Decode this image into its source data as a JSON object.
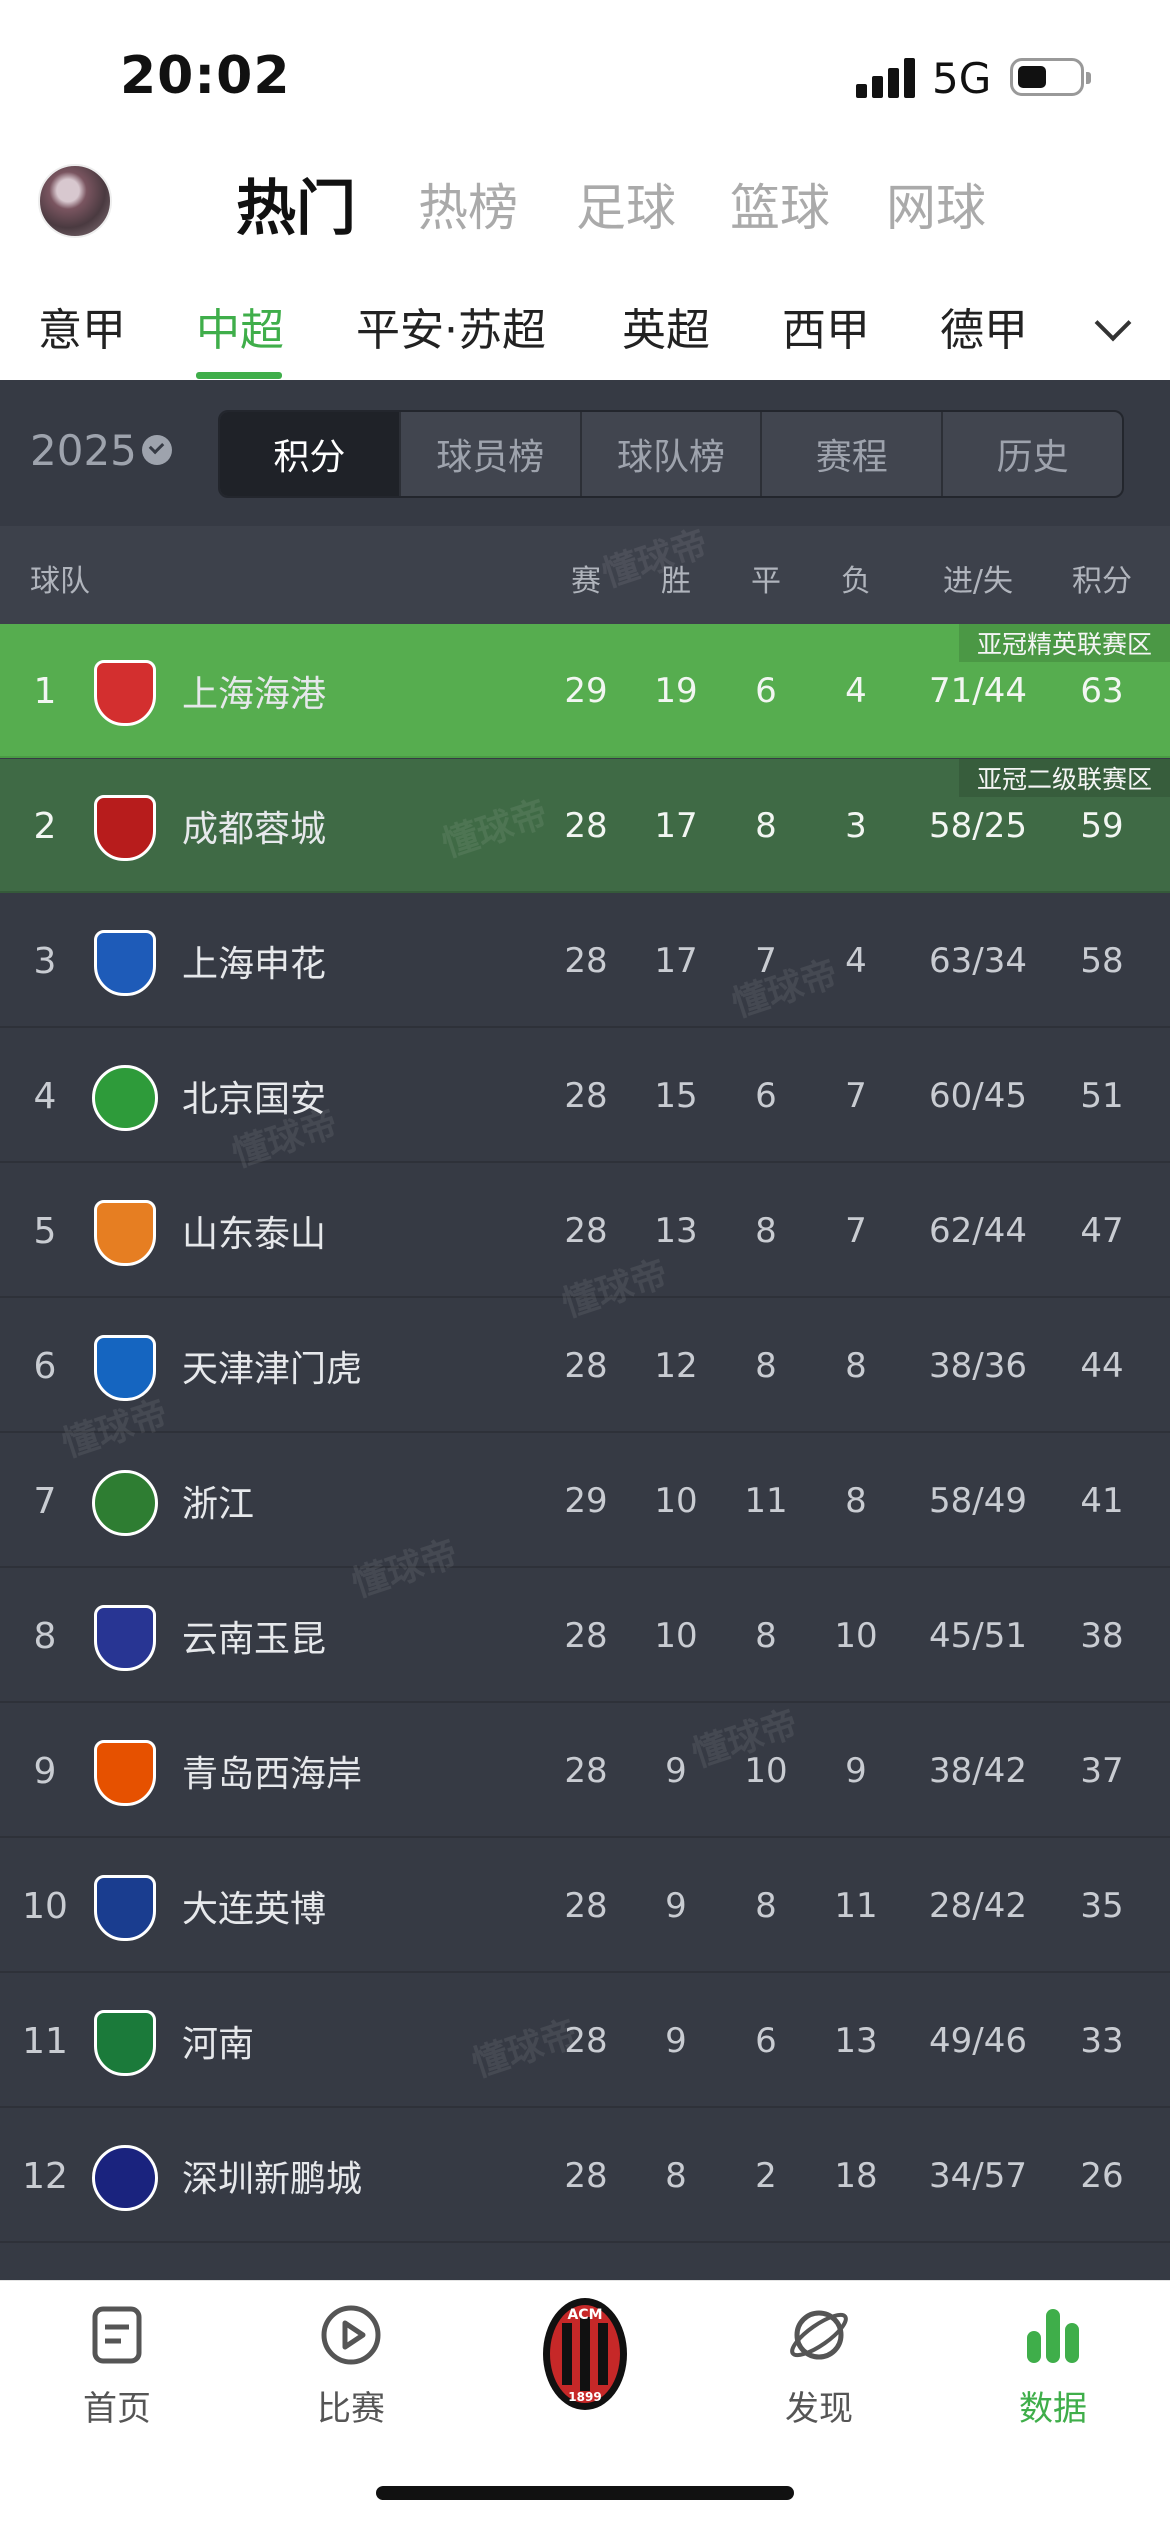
{
  "status_bar": {
    "time": "20:02",
    "network": "5G"
  },
  "top_tabs": [
    "热门",
    "热榜",
    "足球",
    "篮球",
    "网球"
  ],
  "league_tabs": [
    "意甲",
    "中超",
    "平安·苏超",
    "英超",
    "西甲",
    "德甲"
  ],
  "season": "2025",
  "segments": [
    "积分",
    "球员榜",
    "球队榜",
    "赛程",
    "历史"
  ],
  "table_headers": {
    "team": "球队",
    "played": "赛",
    "won": "胜",
    "drawn": "平",
    "lost": "负",
    "goals": "进/失",
    "points": "积分"
  },
  "zones": {
    "elite": "亚冠精英联赛区",
    "two": "亚冠二级联赛区"
  },
  "standings": [
    {
      "rank": "1",
      "team": "上海海港",
      "played": "29",
      "won": "19",
      "drawn": "6",
      "lost": "4",
      "goals": "71/44",
      "points": "63",
      "color": "#d32f2f"
    },
    {
      "rank": "2",
      "team": "成都蓉城",
      "played": "28",
      "won": "17",
      "drawn": "8",
      "lost": "3",
      "goals": "58/25",
      "points": "59",
      "color": "#b71c1c"
    },
    {
      "rank": "3",
      "team": "上海申花",
      "played": "28",
      "won": "17",
      "drawn": "7",
      "lost": "4",
      "goals": "63/34",
      "points": "58",
      "color": "#1e5bb8"
    },
    {
      "rank": "4",
      "team": "北京国安",
      "played": "28",
      "won": "15",
      "drawn": "6",
      "lost": "7",
      "goals": "60/45",
      "points": "51",
      "color": "#2e9b3a"
    },
    {
      "rank": "5",
      "team": "山东泰山",
      "played": "28",
      "won": "13",
      "drawn": "8",
      "lost": "7",
      "goals": "62/44",
      "points": "47",
      "color": "#e67e22"
    },
    {
      "rank": "6",
      "team": "天津津门虎",
      "played": "28",
      "won": "12",
      "drawn": "8",
      "lost": "8",
      "goals": "38/36",
      "points": "44",
      "color": "#1565c0"
    },
    {
      "rank": "7",
      "team": "浙江",
      "played": "29",
      "won": "10",
      "drawn": "11",
      "lost": "8",
      "goals": "58/49",
      "points": "41",
      "color": "#2e7d32"
    },
    {
      "rank": "8",
      "team": "云南玉昆",
      "played": "28",
      "won": "10",
      "drawn": "8",
      "lost": "10",
      "goals": "45/51",
      "points": "38",
      "color": "#283593"
    },
    {
      "rank": "9",
      "team": "青岛西海岸",
      "played": "28",
      "won": "9",
      "drawn": "10",
      "lost": "9",
      "goals": "38/42",
      "points": "37",
      "color": "#e65100"
    },
    {
      "rank": "10",
      "team": "大连英博",
      "played": "28",
      "won": "9",
      "drawn": "8",
      "lost": "11",
      "goals": "28/42",
      "points": "35",
      "color": "#1a3d8f"
    },
    {
      "rank": "11",
      "team": "河南",
      "played": "28",
      "won": "9",
      "drawn": "6",
      "lost": "13",
      "goals": "49/46",
      "points": "33",
      "color": "#1b7a3a"
    },
    {
      "rank": "12",
      "team": "深圳新鹏城",
      "played": "28",
      "won": "8",
      "drawn": "2",
      "lost": "18",
      "goals": "34/57",
      "points": "26",
      "color": "#1a237e"
    }
  ],
  "watermark_text": "懂球帝",
  "bottom_tabs": [
    "首页",
    "比赛",
    "",
    "发现",
    "数据"
  ],
  "colors": {
    "accent": "#3fae4a",
    "elite_zone": "#56ad4f",
    "two_zone": "#3f6a45",
    "dark_bg": "#363a44"
  }
}
